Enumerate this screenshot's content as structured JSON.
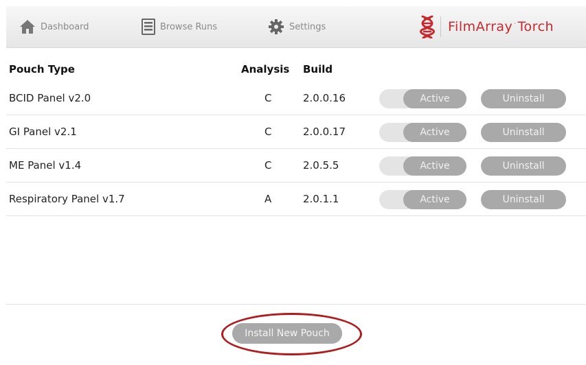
{
  "topbar": {
    "dashboard_label": "Dashboard",
    "browse_label": "Browse Runs",
    "settings_label": "Settings",
    "brand_name": "FilmArray",
    "brand_mark": "·",
    "brand_product": "Torch"
  },
  "table": {
    "headers": {
      "pouch_type": "Pouch Type",
      "analysis": "Analysis",
      "build": "Build"
    },
    "rows": [
      {
        "name": "BCID Panel v2.0",
        "analysis": "C",
        "build": "2.0.0.16",
        "status": "Active",
        "action": "Uninstall"
      },
      {
        "name": "GI Panel v2.1",
        "analysis": "C",
        "build": "2.0.0.17",
        "status": "Active",
        "action": "Uninstall"
      },
      {
        "name": "ME Panel v1.4",
        "analysis": "C",
        "build": "2.0.5.5",
        "status": "Active",
        "action": "Uninstall"
      },
      {
        "name": "Respiratory Panel v1.7",
        "analysis": "A",
        "build": "2.0.1.1",
        "status": "Active",
        "action": "Uninstall"
      }
    ]
  },
  "footer": {
    "install_label": "Install New Pouch"
  },
  "colors": {
    "brand_red": "#c8272d",
    "annotation_red": "#b01c1e",
    "button_gray": "#a9a9a9"
  },
  "icons": {
    "dashboard": "home-icon",
    "browse": "list-icon",
    "settings": "gear-icon",
    "brand": "dna-helix-logo"
  }
}
